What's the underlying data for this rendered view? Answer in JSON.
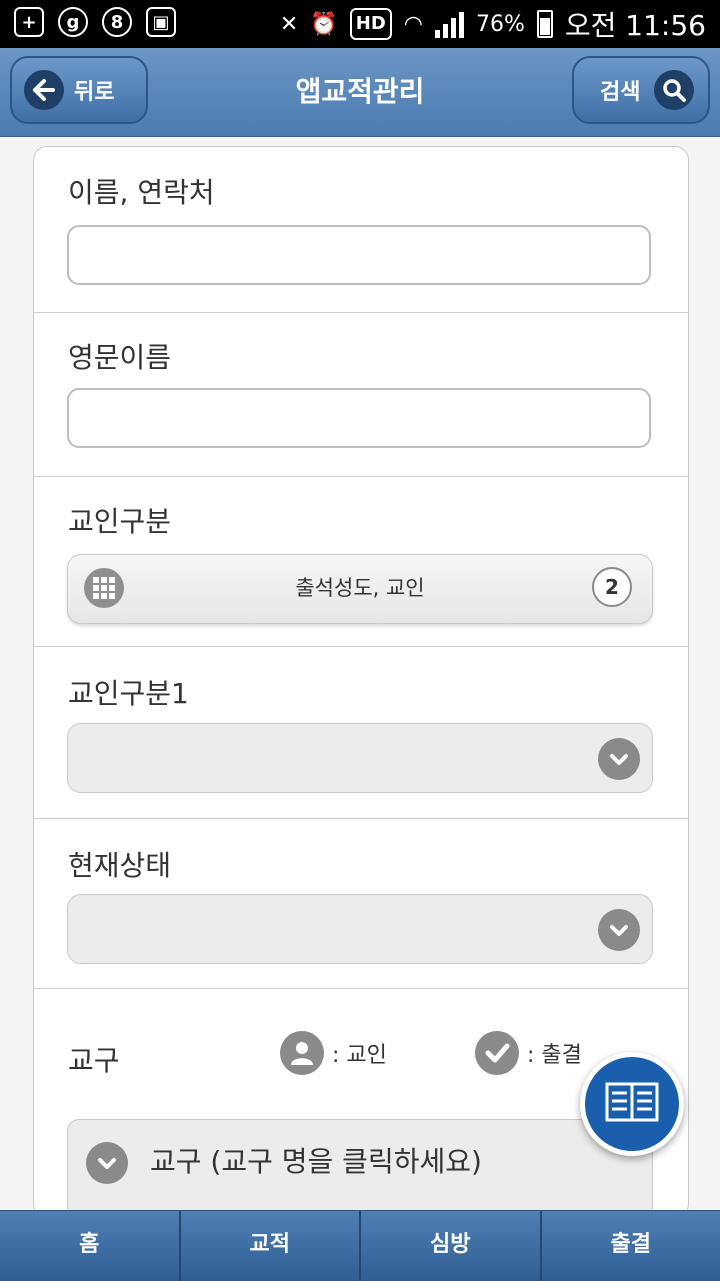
{
  "status_bar": {
    "battery": "76%",
    "time": "오전 11:56",
    "hd": "HD"
  },
  "header": {
    "back_label": "뒤로",
    "title": "앱교적관리",
    "search_label": "검색"
  },
  "form": {
    "name_contact": {
      "label": "이름, 연락처",
      "value": ""
    },
    "english_name": {
      "label": "영문이름",
      "value": ""
    },
    "member_type": {
      "label": "교인구분",
      "selected": "출석성도, 교인",
      "count": "2"
    },
    "member_type1": {
      "label": "교인구분1",
      "selected": ""
    },
    "current_status": {
      "label": "현재상태",
      "selected": ""
    },
    "district": {
      "label": "교구",
      "legend_member": ": 교인",
      "legend_attendance": ": 출결",
      "group_text": "교구 (교구 명을 클릭하세요)"
    }
  },
  "bottom_nav": {
    "items": [
      {
        "label": "홈"
      },
      {
        "label": "교적"
      },
      {
        "label": "심방"
      },
      {
        "label": "출결"
      }
    ]
  },
  "colors": {
    "header": "#5a87ba",
    "fab": "#1a5fae",
    "chevron": "#8a8a8a"
  }
}
